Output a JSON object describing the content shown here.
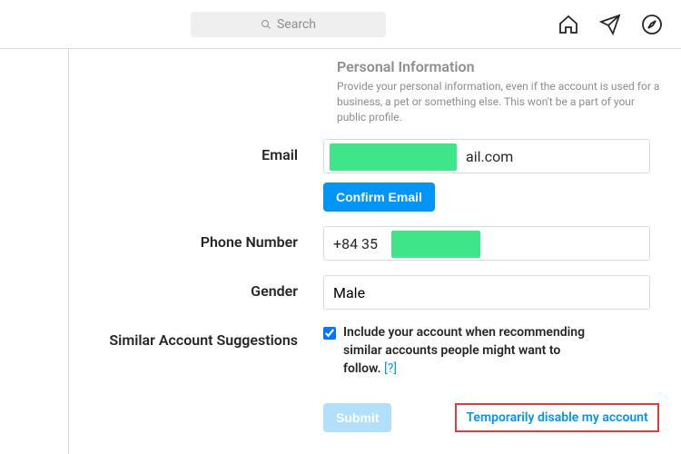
{
  "header": {
    "search_placeholder": "Search"
  },
  "section": {
    "title": "Personal Information",
    "description": "Provide your personal information, even if the account is used for a business, a pet or something else. This won't be a part of your public profile."
  },
  "labels": {
    "email": "Email",
    "phone": "Phone Number",
    "gender": "Gender",
    "suggestions": "Similar Account Suggestions"
  },
  "fields": {
    "email_suffix": "ail.com",
    "phone_prefix": "+84 35",
    "gender_value": "Male"
  },
  "buttons": {
    "confirm_email": "Confirm Email",
    "submit": "Submit"
  },
  "suggestions_checkbox": {
    "label": "Include your account when recommending similar accounts people might want to follow.",
    "help": "[?]"
  },
  "links": {
    "disable_account": "Temporarily disable my account"
  }
}
